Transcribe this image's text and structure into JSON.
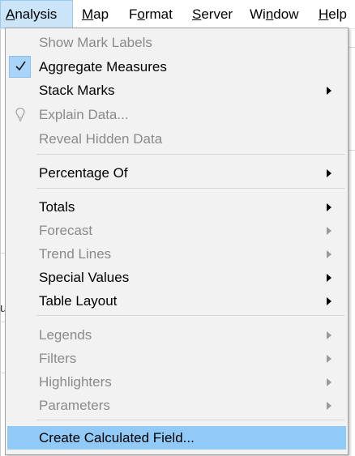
{
  "menubar": {
    "items": [
      {
        "label": "Analysis",
        "mnemonic_index": 0
      },
      {
        "label": "Map",
        "mnemonic_index": 0
      },
      {
        "label": "Format",
        "mnemonic_index": 1
      },
      {
        "label": "Server",
        "mnemonic_index": 0
      },
      {
        "label": "Window",
        "mnemonic_index": 2
      },
      {
        "label": "Help",
        "mnemonic_index": 0
      }
    ],
    "active": "Analysis"
  },
  "background": {
    "fragment_left": "u"
  },
  "menu": {
    "items": [
      {
        "label": "Show Mark Labels",
        "enabled": false
      },
      {
        "label": "Aggregate Measures",
        "enabled": true,
        "checked": true
      },
      {
        "label": "Stack Marks",
        "enabled": true,
        "submenu": true
      },
      {
        "label": "Explain Data...",
        "enabled": false,
        "icon": "lightbulb-icon"
      },
      {
        "label": "Reveal Hidden Data",
        "enabled": false
      },
      {
        "label": "Percentage Of",
        "enabled": true,
        "submenu": true
      },
      {
        "label": "Totals",
        "enabled": true,
        "submenu": true
      },
      {
        "label": "Forecast",
        "enabled": false,
        "submenu": true
      },
      {
        "label": "Trend Lines",
        "enabled": false,
        "submenu": true
      },
      {
        "label": "Special Values",
        "enabled": true,
        "submenu": true
      },
      {
        "label": "Table Layout",
        "enabled": true,
        "submenu": true
      },
      {
        "label": "Legends",
        "enabled": false,
        "submenu": true
      },
      {
        "label": "Filters",
        "enabled": false,
        "submenu": true
      },
      {
        "label": "Highlighters",
        "enabled": false,
        "submenu": true
      },
      {
        "label": "Parameters",
        "enabled": false,
        "submenu": true
      },
      {
        "label": "Create Calculated Field...",
        "enabled": true,
        "highlighted": true
      }
    ]
  },
  "colors": {
    "highlight": "#91c9f7",
    "checked_bg": "#a9d4f7",
    "menubar_active": "#cce4f7",
    "disabled_text": "#8a8a8a"
  }
}
